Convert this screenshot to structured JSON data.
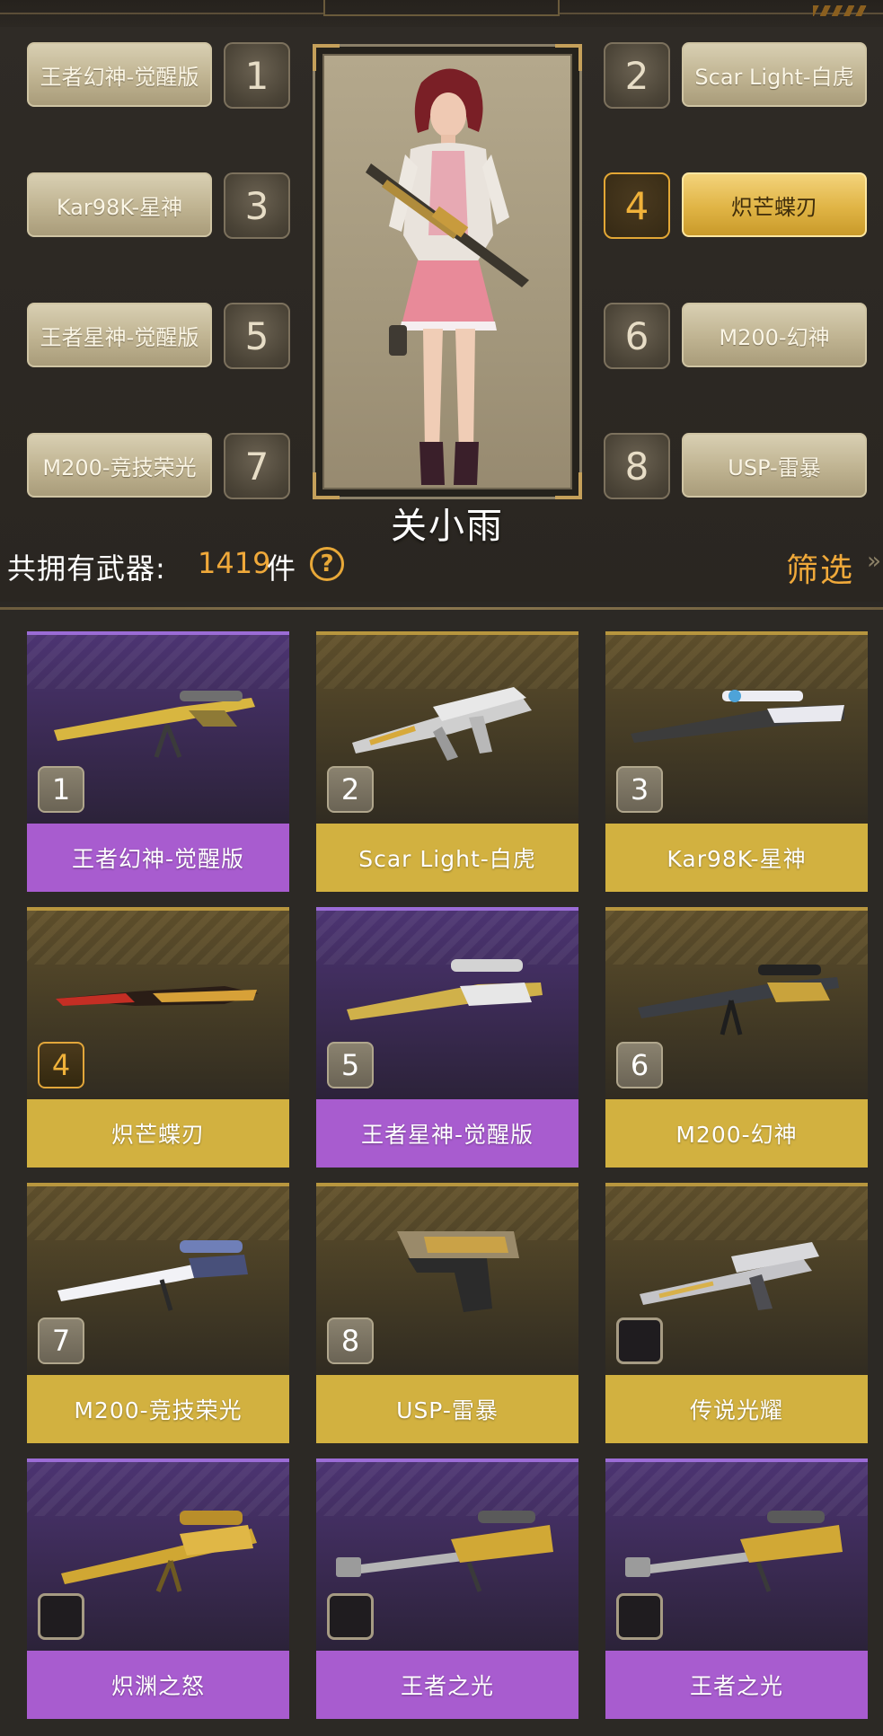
{
  "loadout": {
    "character_name": "关小雨",
    "slots": [
      {
        "num": "1",
        "label": "王者幻神-觉醒版"
      },
      {
        "num": "2",
        "label": "Scar Light-白虎"
      },
      {
        "num": "3",
        "label": "Kar98K-星神"
      },
      {
        "num": "4",
        "label": "炽芒蝶刃"
      },
      {
        "num": "5",
        "label": "王者星神-觉醒版"
      },
      {
        "num": "6",
        "label": "M200-幻神"
      },
      {
        "num": "7",
        "label": "M200-竞技荣光"
      },
      {
        "num": "8",
        "label": "USP-雷暴"
      }
    ],
    "selected_slot": "4"
  },
  "inventory": {
    "count_label": "共拥有武器:",
    "count_value": "1419",
    "count_unit": "件",
    "help_icon": "question-circle-icon",
    "filter_label": "筛选",
    "filter_icon": "double-chevron-down-icon"
  },
  "weapons": [
    {
      "name": "王者幻神-觉醒版",
      "slot": "1",
      "rarity": "purple",
      "icon": "sniper-rifle-icon"
    },
    {
      "name": "Scar Light-白虎",
      "slot": "2",
      "rarity": "gold",
      "icon": "assault-rifle-icon"
    },
    {
      "name": "Kar98K-星神",
      "slot": "3",
      "rarity": "gold",
      "icon": "bolt-rifle-icon"
    },
    {
      "name": "炽芒蝶刃",
      "slot": "4",
      "rarity": "gold",
      "icon": "butterfly-knife-icon"
    },
    {
      "name": "王者星神-觉醒版",
      "slot": "5",
      "rarity": "purple",
      "icon": "sniper-rifle-icon"
    },
    {
      "name": "M200-幻神",
      "slot": "6",
      "rarity": "gold",
      "icon": "sniper-rifle-icon"
    },
    {
      "name": "M200-竞技荣光",
      "slot": "7",
      "rarity": "gold",
      "icon": "sniper-rifle-icon"
    },
    {
      "name": "USP-雷暴",
      "slot": "8",
      "rarity": "gold",
      "icon": "pistol-icon"
    },
    {
      "name": "传说光耀",
      "slot": "",
      "rarity": "gold",
      "icon": "assault-rifle-icon"
    },
    {
      "name": "炽渊之怒",
      "slot": "",
      "rarity": "purple",
      "icon": "sniper-rifle-icon"
    },
    {
      "name": "王者之光",
      "slot": "",
      "rarity": "purple",
      "icon": "heavy-sniper-icon"
    },
    {
      "name": "王者之光",
      "slot": "",
      "rarity": "purple",
      "icon": "heavy-sniper-icon"
    }
  ],
  "colors": {
    "accent_orange": "#f0a93a",
    "purple_rarity": "#a85ccf",
    "gold_rarity": "#d2b140"
  }
}
